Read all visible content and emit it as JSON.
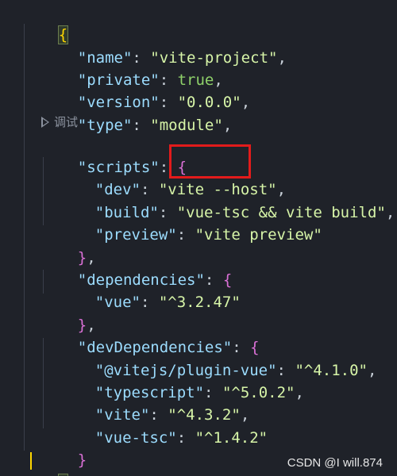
{
  "editor": {
    "lines": [
      {
        "open": "{"
      },
      {
        "key": "\"name\"",
        "value": "\"vite-project\"",
        "comma": ","
      },
      {
        "key": "\"private\"",
        "value": "true",
        "comma": ","
      },
      {
        "key": "\"version\"",
        "value": "\"0.0.0\"",
        "comma": ","
      },
      {
        "key": "\"type\"",
        "value": "\"module\"",
        "comma": ","
      },
      {
        "codelens": "调试"
      },
      {
        "key": "\"scripts\"",
        "open": "{"
      },
      {
        "key": "\"dev\"",
        "value_a": "\"vite ",
        "value_b": "--host\"",
        "comma": ","
      },
      {
        "key": "\"build\"",
        "value": "\"vue-tsc && vite build\"",
        "comma": ","
      },
      {
        "key": "\"preview\"",
        "value": "\"vite preview\""
      },
      {
        "close": "}",
        "comma": ","
      },
      {
        "key": "\"dependencies\"",
        "open": "{"
      },
      {
        "key": "\"vue\"",
        "value": "\"^3.2.47\""
      },
      {
        "close": "}",
        "comma": ","
      },
      {
        "key": "\"devDependencies\"",
        "open": "{"
      },
      {
        "key": "\"@vitejs/plugin-vue\"",
        "value": "\"^4.1.0\"",
        "comma": ","
      },
      {
        "key": "\"typescript\"",
        "value": "\"^5.0.2\"",
        "comma": ","
      },
      {
        "key": "\"vite\"",
        "value": "\"^4.3.2\"",
        "comma": ","
      },
      {
        "key": "\"vue-tsc\"",
        "value": "\"^1.4.2\""
      },
      {
        "close": "}"
      },
      {
        "close": "}"
      }
    ]
  },
  "watermark": "CSDN @I will.874",
  "colors": {
    "background": "#1f2229",
    "key": "#9cdcfe",
    "string": "#d7f5a8",
    "boolean": "#8fd16a",
    "brace_outer": "#ffd700",
    "brace_inner": "#da70d6",
    "annotation_box": "#e21b1b"
  }
}
